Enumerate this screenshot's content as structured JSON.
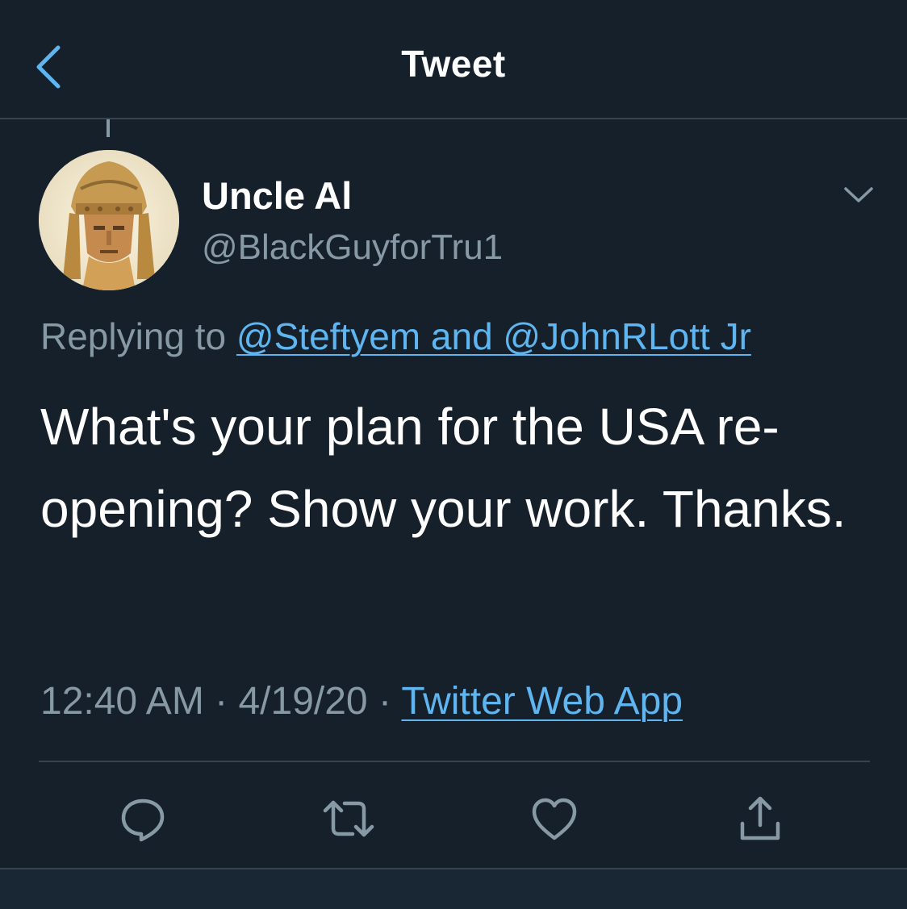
{
  "header": {
    "title": "Tweet",
    "back_icon": "chevron-left-icon"
  },
  "tweet": {
    "author": {
      "display_name": "Uncle Al",
      "handle": "@BlackGuyforTru1",
      "avatar": "profile-photo"
    },
    "replying_to": {
      "prefix": "Replying to ",
      "mentions": "@Steftyem and @JohnRLott Jr"
    },
    "text": "What's your plan for the USA re-opening? Show your work. Thanks.",
    "time": "12:40 AM",
    "separator": " · ",
    "date": "4/19/20",
    "source": "Twitter Web App",
    "more_icon": "chevron-down-icon"
  },
  "actions": [
    {
      "name": "reply",
      "icon": "reply-icon"
    },
    {
      "name": "retweet",
      "icon": "retweet-icon"
    },
    {
      "name": "like",
      "icon": "heart-icon"
    },
    {
      "name": "share",
      "icon": "share-icon"
    }
  ],
  "colors": {
    "background": "#15202b",
    "accent": "#5eb5f0",
    "secondary_text": "#8899a6",
    "border": "#38444d"
  }
}
